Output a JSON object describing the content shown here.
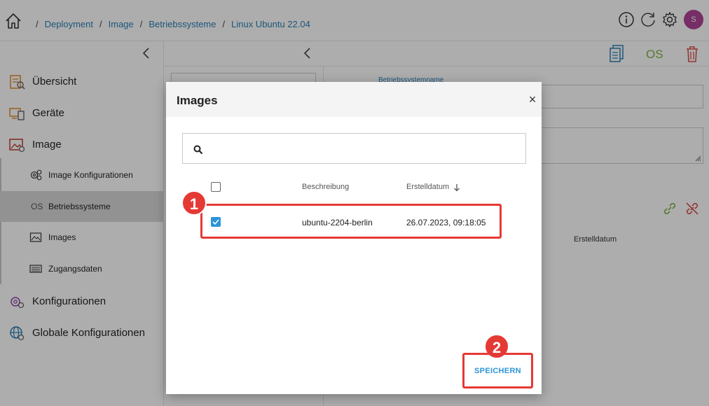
{
  "header": {
    "home_icon": "home-icon",
    "breadcrumb": [
      "Deployment",
      "Image",
      "Betriebssysteme",
      "Linux Ubuntu 22.04"
    ],
    "separator": "/",
    "icons": [
      "info-icon",
      "refresh-icon",
      "gear-icon"
    ],
    "avatar_initial": "S",
    "avatar_color": "#b04395"
  },
  "sidebar": {
    "items": [
      {
        "label": "Übersicht",
        "icon": "overview-icon"
      },
      {
        "label": "Geräte",
        "icon": "devices-icon"
      },
      {
        "label": "Image",
        "icon": "image-icon"
      }
    ],
    "sub_items": [
      {
        "label": "Image Konfigurationen",
        "icon": "gears-icon"
      },
      {
        "label": "Betriebssysteme",
        "icon_text": "OS"
      },
      {
        "label": "Images",
        "icon": "picture-icon"
      },
      {
        "label": "Zugangsdaten",
        "icon": "credentials-icon"
      }
    ],
    "items_bottom": [
      {
        "label": "Konfigurationen",
        "icon": "configurations-icon"
      },
      {
        "label": "Globale Konfigurationen",
        "icon": "global-config-icon"
      }
    ]
  },
  "main": {
    "os_label": "OS",
    "field_label": "Betriebssystemname",
    "column_erstelldatum": "Erstelldatum"
  },
  "modal": {
    "title": "Images",
    "close": "×",
    "search_placeholder": "",
    "columns": {
      "description": "Beschreibung",
      "date": "Erstelldatum"
    },
    "rows": [
      {
        "description": "ubuntu-2204-berlin",
        "date": "26.07.2023, 09:18:05",
        "checked": true
      }
    ],
    "save_label": "SPEICHERN",
    "badges": [
      "1",
      "2"
    ]
  },
  "colors": {
    "accent": "#2a95d8",
    "breadcrumb": "#2a7fb5",
    "highlight": "#e53935",
    "os_green": "#7cb342"
  }
}
